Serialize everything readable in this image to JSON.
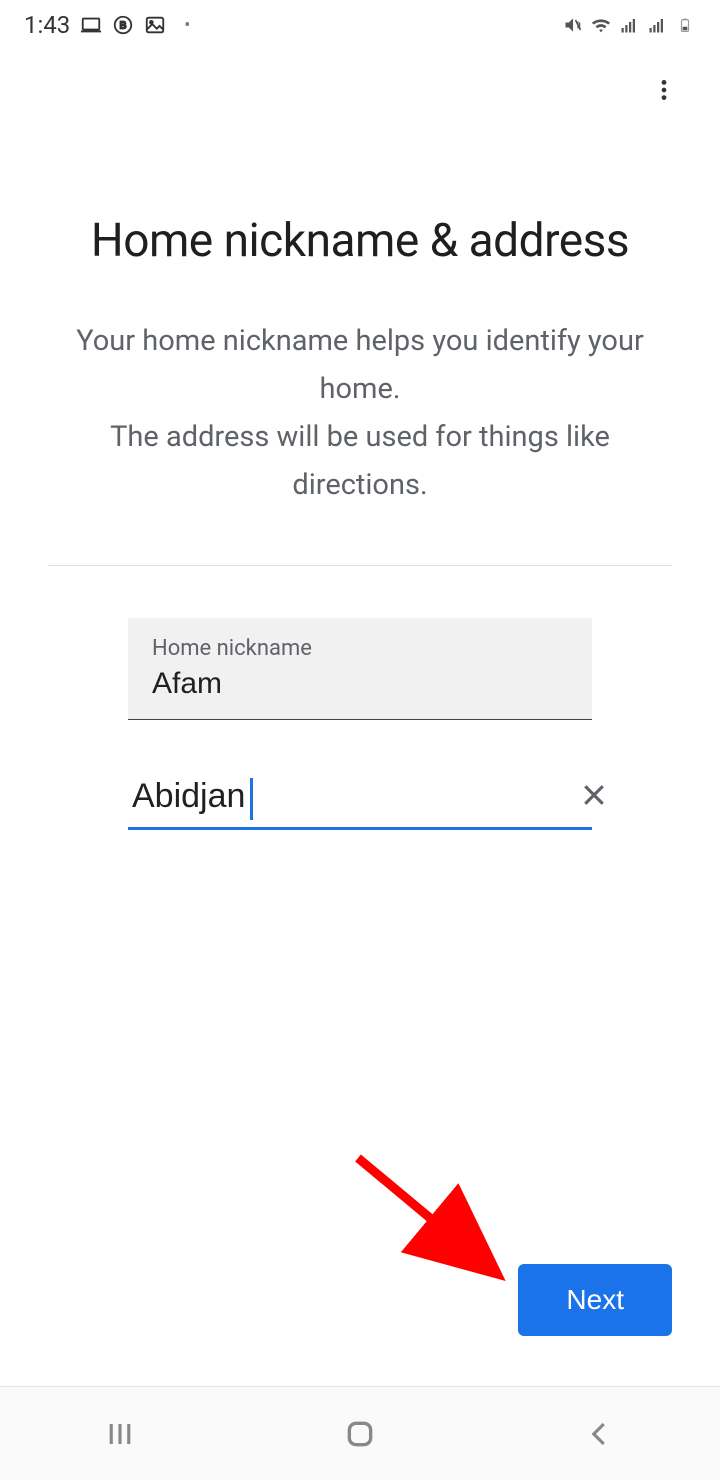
{
  "status": {
    "time": "1:43"
  },
  "page": {
    "title": "Home nickname & address",
    "subtitle": "Your home nickname helps you identify your home.\nThe address will be used for things like directions."
  },
  "form": {
    "nickname_label": "Home nickname",
    "nickname_value": "Afam",
    "address_value": "Abidjan"
  },
  "actions": {
    "next_label": "Next"
  },
  "colors": {
    "accent": "#1a73e8"
  }
}
